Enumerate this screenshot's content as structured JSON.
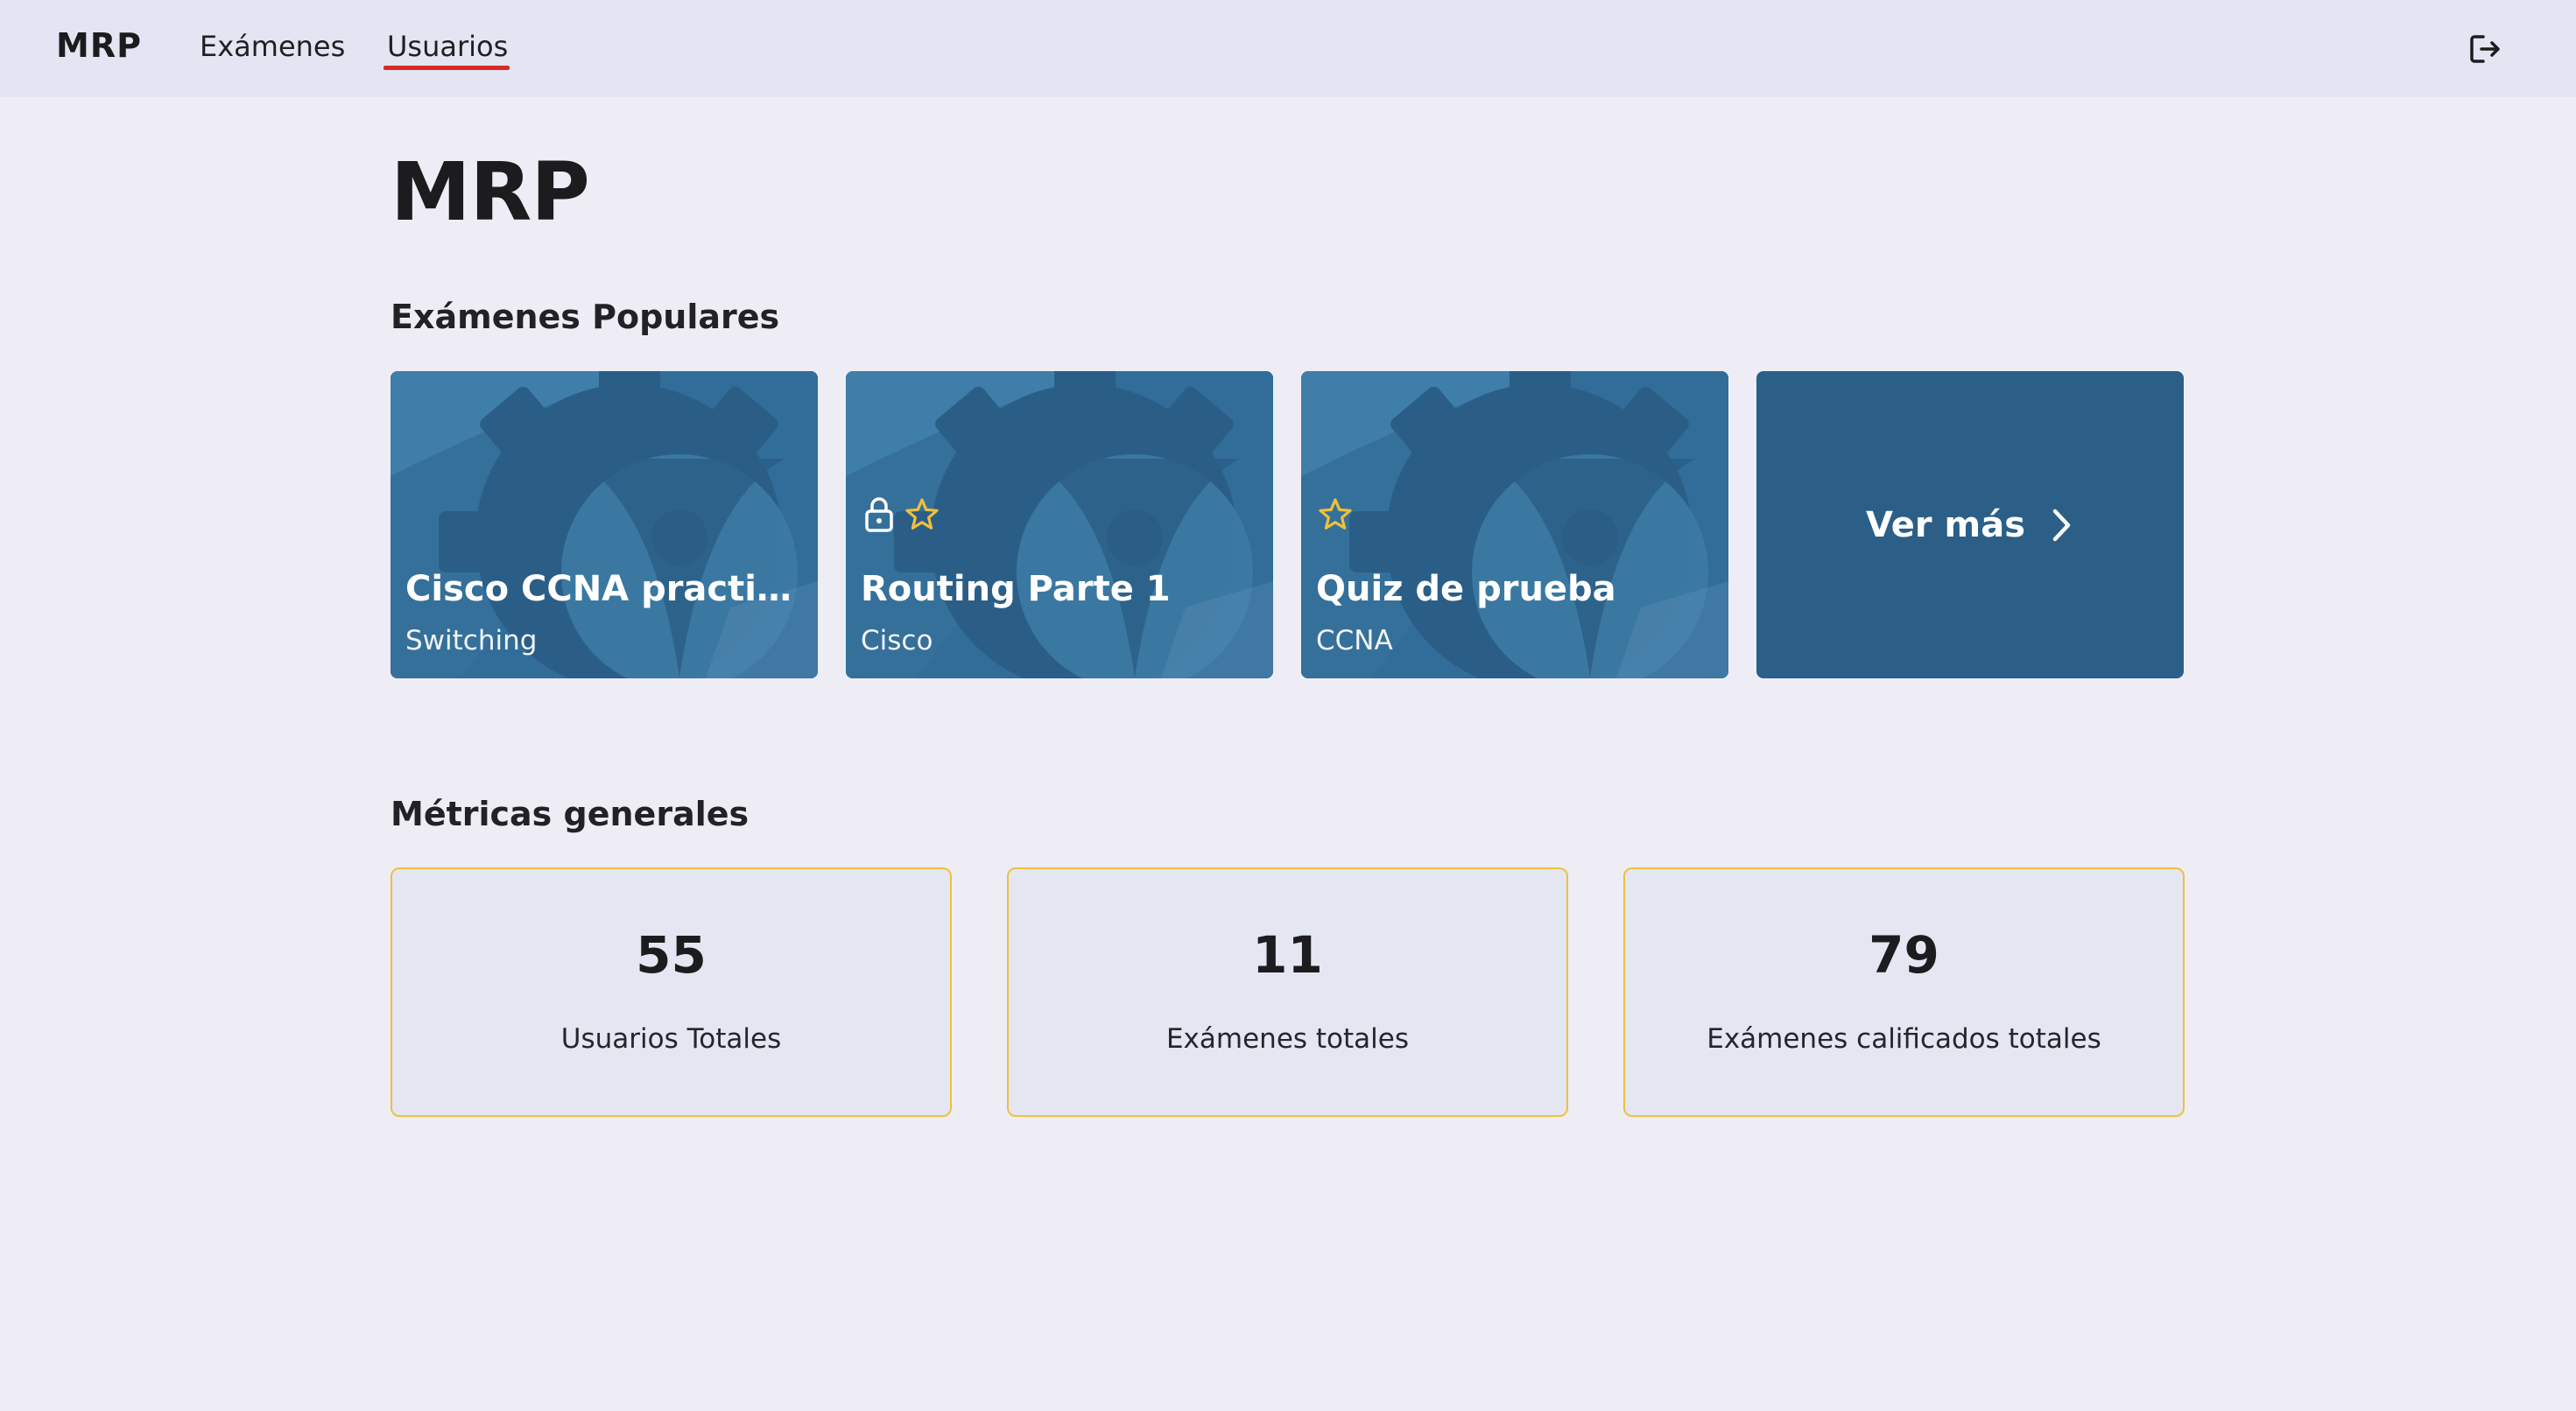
{
  "header": {
    "brand": "MRP",
    "nav": [
      {
        "label": "Exámenes",
        "active": false
      },
      {
        "label": "Usuarios",
        "active": true
      }
    ],
    "logout_icon": "logout-icon"
  },
  "main": {
    "title": "MRP",
    "popular_title": "Exámenes Populares",
    "exams": [
      {
        "title": "Cisco CCNA practice ...",
        "subtitle": "Switching",
        "locked": false,
        "starred": false
      },
      {
        "title": "Routing Parte 1",
        "subtitle": "Cisco",
        "locked": true,
        "starred": true
      },
      {
        "title": "Quiz de prueba",
        "subtitle": "CCNA",
        "locked": false,
        "starred": true
      }
    ],
    "see_more": {
      "label": "Ver más",
      "icon": "chevron-right-icon"
    },
    "metrics_title": "Métricas generales",
    "metrics": [
      {
        "value": "55",
        "label": "Usuarios Totales"
      },
      {
        "value": "11",
        "label": "Exámenes totales"
      },
      {
        "value": "79",
        "label": "Exámenes calificados totales"
      }
    ]
  },
  "colors": {
    "background": "#eeedf6",
    "header": "#e3e6f2",
    "card": "#2b6089",
    "accent_underline": "#d62a2a",
    "star": "#f0bf3c",
    "metric_border": "#f0bf3c"
  }
}
